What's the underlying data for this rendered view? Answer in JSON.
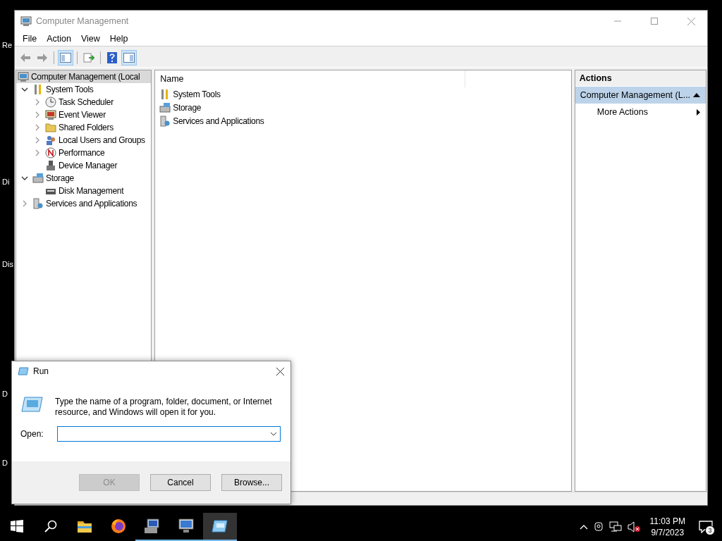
{
  "desktop": {
    "labels": [
      "Re",
      "Di",
      "Dis",
      "D",
      "D"
    ]
  },
  "window": {
    "title": "Computer Management"
  },
  "menu": [
    "File",
    "Action",
    "View",
    "Help"
  ],
  "toolbar": [
    {
      "selected": false
    },
    {
      "selected": false
    },
    {
      "selected": true
    },
    {
      "selected": false
    },
    {
      "selected": false
    },
    {
      "selected": true
    }
  ],
  "tree": [
    {
      "label": "Computer Management (Local",
      "selected": true,
      "children": [
        {
          "label": "System Tools",
          "expanded": true,
          "children": [
            {
              "label": "Task Scheduler",
              "expanded": false
            },
            {
              "label": "Event Viewer",
              "expanded": false
            },
            {
              "label": "Shared Folders",
              "expanded": false
            },
            {
              "label": "Local Users and Groups",
              "expanded": false
            },
            {
              "label": "Performance",
              "expanded": false
            },
            {
              "label": "Device Manager"
            }
          ]
        },
        {
          "label": "Storage",
          "expanded": true,
          "children": [
            {
              "label": "Disk Management"
            }
          ]
        },
        {
          "label": "Services and Applications",
          "expanded": false
        }
      ]
    }
  ],
  "list": {
    "columns": [
      "Name"
    ],
    "rows": [
      "System Tools",
      "Storage",
      "Services and Applications"
    ]
  },
  "actions": {
    "title": "Actions",
    "group": {
      "label": "Computer Management (L...",
      "expanded": true
    },
    "items": [
      "More Actions"
    ]
  },
  "run_dialog": {
    "title": "Run",
    "description": "Type the name of a program, folder, document, or Internet resource, and Windows will open it for you.",
    "open_label": "Open:",
    "buttons": [
      {
        "label": "OK",
        "disabled": true
      },
      {
        "label": "Cancel",
        "disabled": false
      },
      {
        "label": "Browse...",
        "disabled": false
      }
    ]
  },
  "taskbar": {
    "apps": [
      {
        "running": false,
        "selected": false
      },
      {
        "running": false,
        "selected": false
      },
      {
        "running": true,
        "selected": false
      },
      {
        "running": true,
        "selected": false
      },
      {
        "running": true,
        "selected": true
      }
    ],
    "time": "11:03 PM",
    "date": "9/7/2023",
    "notifications": "3"
  }
}
